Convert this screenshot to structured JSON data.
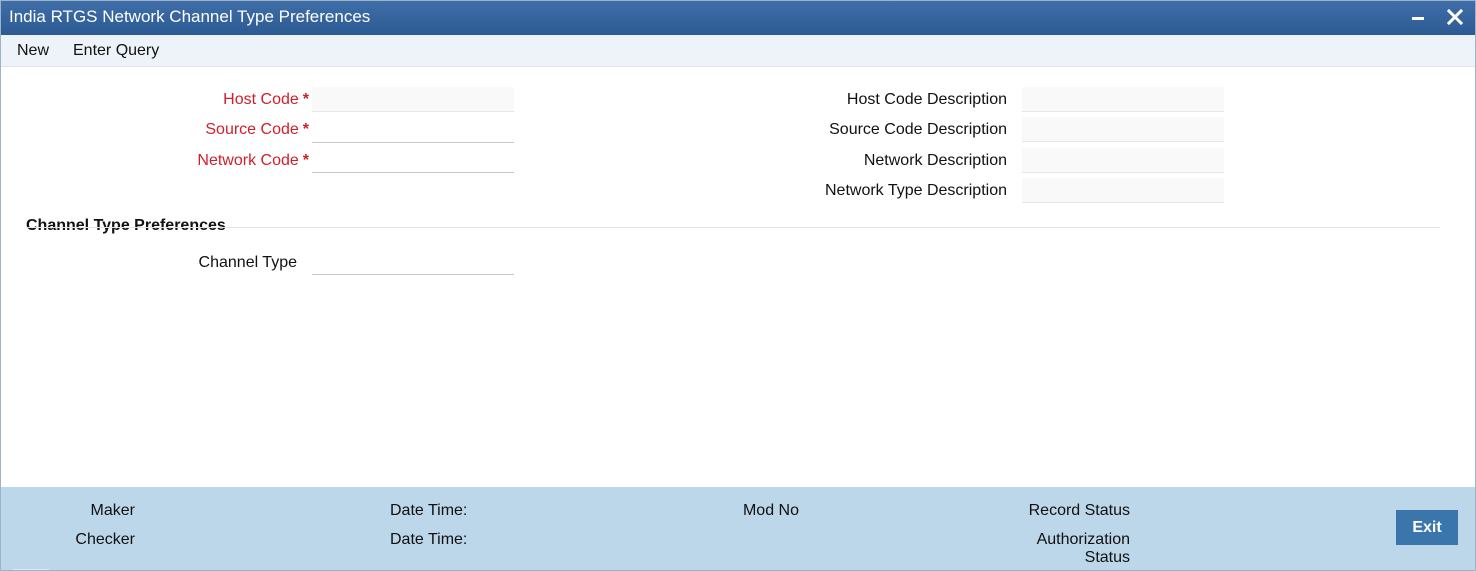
{
  "window": {
    "title": "India RTGS Network Channel Type Preferences",
    "minimize_icon": "minimize-icon",
    "close_icon": "close-icon"
  },
  "menu": {
    "new_label": "New",
    "enter_query_label": "Enter Query"
  },
  "form": {
    "host_code": {
      "label": "Host Code",
      "required_mark": "*",
      "value": ""
    },
    "source_code": {
      "label": "Source Code",
      "required_mark": "*",
      "value": ""
    },
    "network_code": {
      "label": "Network Code",
      "required_mark": "*",
      "value": ""
    },
    "host_code_description": {
      "label": "Host Code Description",
      "value": ""
    },
    "source_code_description": {
      "label": "Source Code Description",
      "value": ""
    },
    "network_description": {
      "label": "Network Description",
      "value": ""
    },
    "network_type_description": {
      "label": "Network Type Description",
      "value": ""
    }
  },
  "section": {
    "title": "Channel Type Preferences",
    "channel_type": {
      "label": "Channel Type",
      "value": ""
    }
  },
  "footer": {
    "maker_label": "Maker",
    "checker_label": "Checker",
    "date_time_label_1": "Date Time:",
    "date_time_label_2": "Date Time:",
    "mod_no_label": "Mod No",
    "record_status_label": "Record Status",
    "authorization_label": "Authorization",
    "status_label": "Status",
    "exit_label": "Exit"
  },
  "colors": {
    "titlebar": "#2c5a93",
    "required_text": "#d0202a",
    "footer_bg": "#bcd6ea",
    "exit_button": "#3a76ab"
  }
}
